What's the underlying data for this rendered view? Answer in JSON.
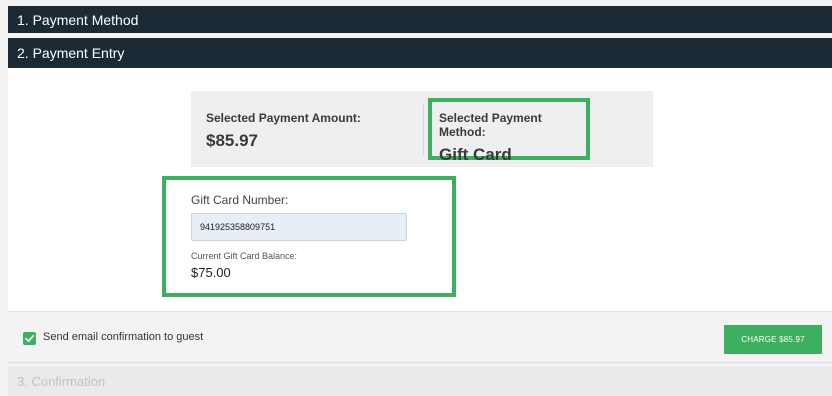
{
  "sections": {
    "payment_method": "1. Payment Method",
    "payment_entry": "2. Payment Entry",
    "confirmation": "3. Confirmation"
  },
  "summary": {
    "amount_label": "Selected Payment Amount:",
    "amount_value": "$85.97",
    "method_label": "Selected Payment Method:",
    "method_value": "Gift Card"
  },
  "gift_card": {
    "number_label": "Gift Card Number:",
    "number_value": "941925358809751",
    "balance_label": "Current Gift Card Balance:",
    "balance_value": "$75.00"
  },
  "footer": {
    "email_confirmation_label": "Send email confirmation to guest",
    "email_confirmation_checked": true,
    "charge_button_label": "CHARGE $85.97"
  },
  "colors": {
    "header_bg": "#1c2a36",
    "highlight": "#3daf5e",
    "accent_green": "#3daf5e"
  }
}
